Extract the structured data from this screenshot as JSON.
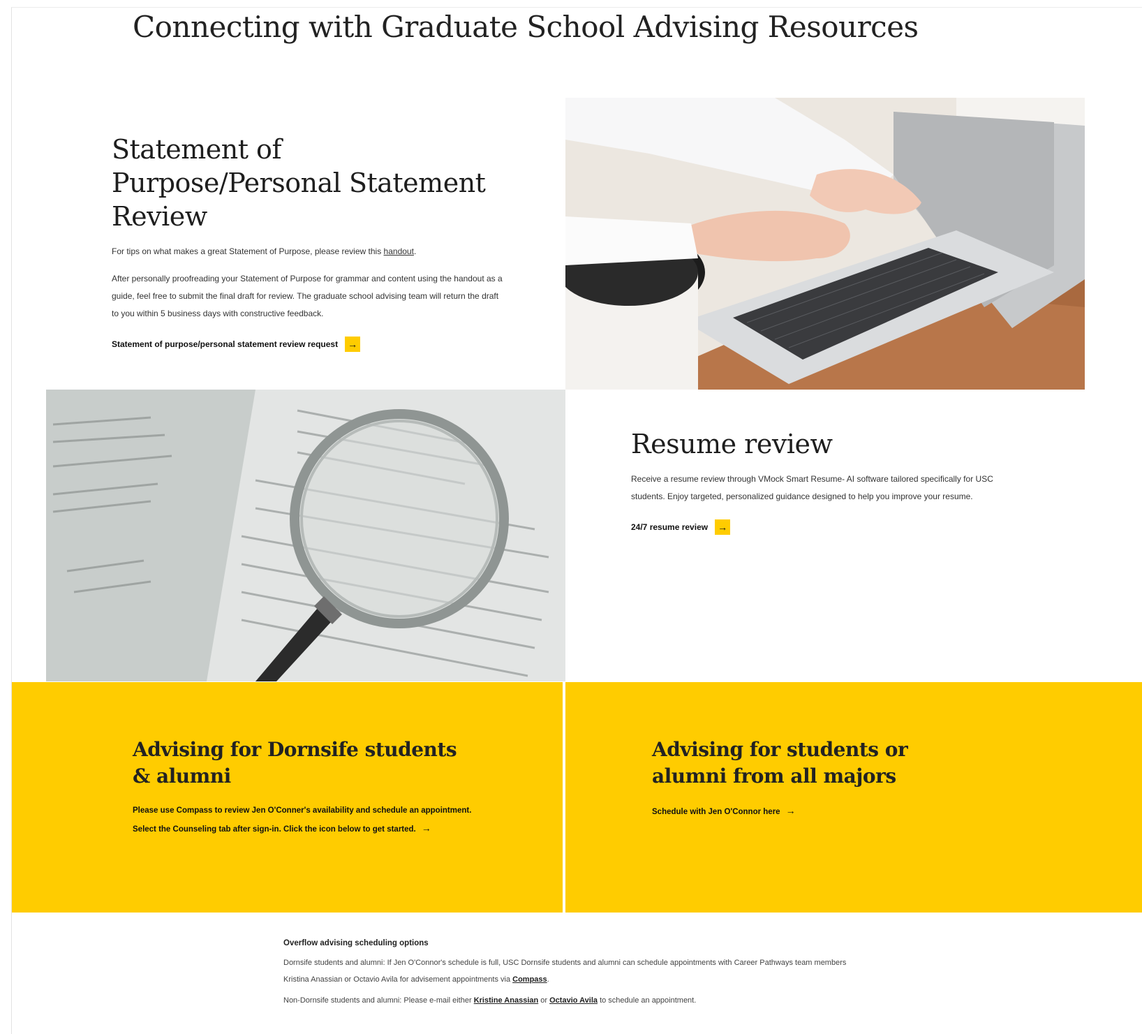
{
  "page": {
    "title": "Connecting with Graduate School Advising Resources"
  },
  "sop": {
    "heading": "Statement of Purpose/Personal Statement Review",
    "tip_prefix": "For tips on what makes a great Statement of Purpose, please review this",
    "tip_link": "handout",
    "tip_suffix": ".",
    "paragraph": "After personally proofreading your Statement of Purpose for grammar and content using the handout as a guide, feel free to submit the final draft for review.  The graduate school advising team will return the draft to you within 5 business days with constructive feedback.",
    "cta_label": "Statement of purpose/personal statement review request",
    "cta_icon": "arrow-right-icon"
  },
  "resume": {
    "heading": "Resume review",
    "paragraph": "Receive a resume review through VMock Smart Resume- AI software tailored specifically for USC students.  Enjoy targeted, personalized guidance designed to help you improve your resume.",
    "cta_label": "24/7 resume review",
    "cta_icon": "arrow-right-icon"
  },
  "advising_dornsife": {
    "heading": "Advising for Dornsife students & alumni",
    "text": "Please use Compass to review Jen O'Conner's availability and schedule an appointment. Select the Counseling tab after sign-in.  Click the icon below to get started.",
    "icon": "arrow-right-icon"
  },
  "advising_all": {
    "heading": "Advising for students or alumni from all majors",
    "cta_label": "Schedule with Jen O'Connor here",
    "icon": "arrow-right-icon"
  },
  "overflow": {
    "heading": "Overflow advising scheduling options",
    "line1": "Dornsife students and alumni: If Jen O'Connor's schedule is full, USC Dornsife students and alumni can schedule appointments with Career Pathways team members Kristina Anassian or Octavio Avila for advisement appointments via",
    "compass_link": "Compass",
    "line1_end": ".",
    "line2_prefix": "Non-Dornsife students and alumni: Please e-mail either",
    "link_kristine": "Kristine Anassian",
    "line2_or": "or",
    "link_octavio": "Octavio Avila",
    "line2_suffix": "to schedule an appointment."
  },
  "colors": {
    "accent": "#ffcc00",
    "text": "#1a1a1a"
  }
}
